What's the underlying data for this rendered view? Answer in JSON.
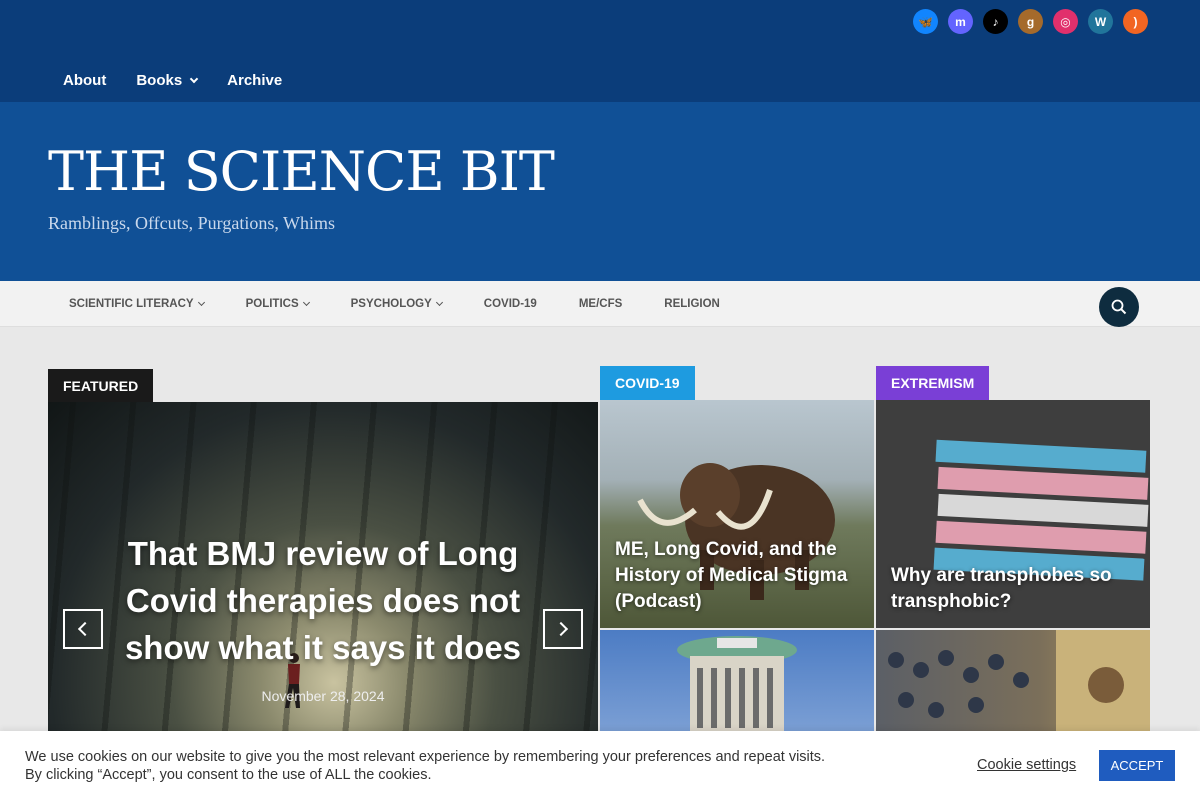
{
  "social": [
    {
      "name": "bluesky",
      "glyph": "🦋",
      "color": "#1185fe"
    },
    {
      "name": "mastodon",
      "glyph": "m",
      "color": "#6364ff"
    },
    {
      "name": "tiktok",
      "glyph": "♪",
      "color": "#000000"
    },
    {
      "name": "goodreads",
      "glyph": "g",
      "color": "#a56a2b"
    },
    {
      "name": "instagram",
      "glyph": "◎",
      "color": "#e1306c"
    },
    {
      "name": "wordpress",
      "glyph": "W",
      "color": "#21759b"
    },
    {
      "name": "rss",
      "glyph": ")",
      "color": "#f26522"
    }
  ],
  "topnav": {
    "about": "About",
    "books": "Books",
    "archive": "Archive"
  },
  "site": {
    "title": "THE SCIENCE BIT",
    "tagline": "Ramblings, Offcuts, Purgations, Whims"
  },
  "catnav": {
    "scientific_literacy": "SCIENTIFIC LITERACY",
    "politics": "POLITICS",
    "psychology": "PSYCHOLOGY",
    "covid19": "COVID-19",
    "mecfs": "ME/CFS",
    "religion": "RELIGION"
  },
  "featured": {
    "tag": "FEATURED",
    "title": "That BMJ review of Long Covid therapies does not show what it says it does",
    "date": "November 28, 2024"
  },
  "tiles": [
    {
      "tag": "COVID-19",
      "title": "ME, Long Covid, and the History of Medical Stigma (Podcast)",
      "tag_color": "#1e9be0"
    },
    {
      "tag": "EXTREMISM",
      "title": "Why are transphobes so transphobic?",
      "tag_color": "#7a3fd6"
    }
  ],
  "cookie": {
    "text": "We use cookies on our website to give you the most relevant experience by remembering your preferences and repeat visits. By clicking “Accept”, you consent to the use of ALL the cookies.",
    "settings": "Cookie settings",
    "accept": "ACCEPT"
  }
}
